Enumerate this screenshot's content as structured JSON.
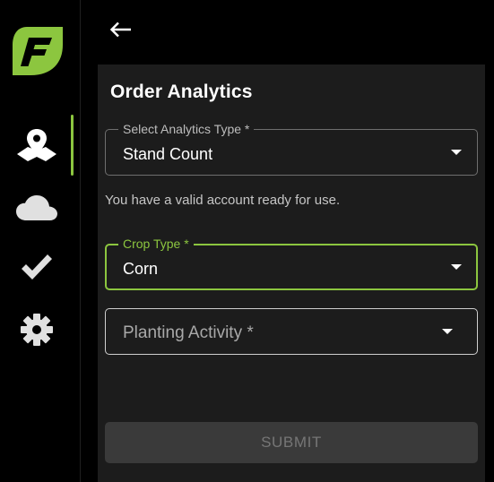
{
  "sidebar": {
    "logo": "brand-logo",
    "accent_color": "#8cc63f",
    "items": [
      {
        "icon": "map-pin-icon",
        "active": true
      },
      {
        "icon": "cloud-icon",
        "active": false
      },
      {
        "icon": "checkmark-icon",
        "active": false
      },
      {
        "icon": "gear-icon",
        "active": false
      }
    ]
  },
  "header": {
    "back_icon": "arrow-left-icon"
  },
  "form": {
    "title": "Order Analytics",
    "analytics_type": {
      "label": "Select Analytics Type *",
      "value": "Stand Count"
    },
    "helper_text": "You have a valid account ready for use.",
    "crop_type": {
      "label": "Crop Type *",
      "value": "Corn",
      "focused": true
    },
    "planting_activity": {
      "placeholder": "Planting Activity *",
      "value": ""
    },
    "submit_label": "SUBMIT",
    "submit_disabled": true
  }
}
